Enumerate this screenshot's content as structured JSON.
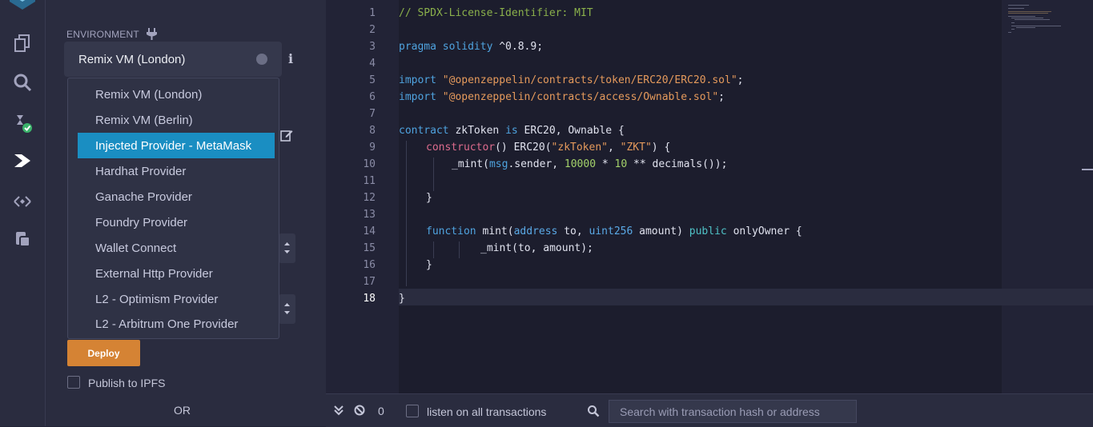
{
  "icons": {
    "logo": "remix-logo-icon",
    "file_explorer": "files-icon",
    "search": "search-icon",
    "compiler": "solidity-compiler-icon",
    "deploy_run": "deploy-run-icon",
    "plugin_manager": "plugin-manager-icon",
    "settings_docs": "docs-icon"
  },
  "panel": {
    "environment_label": "ENVIRONMENT",
    "environment_selected": "Remix VM (London)",
    "info_glyph": "i",
    "dropdown_options": [
      "Remix VM (London)",
      "Remix VM (Berlin)",
      "Injected Provider - MetaMask",
      "Hardhat Provider",
      "Ganache Provider",
      "Foundry Provider",
      "Wallet Connect",
      "External Http Provider",
      "L2 - Optimism Provider",
      "L2 - Arbitrum One Provider"
    ],
    "highlighted_option": "Injected Provider - MetaMask",
    "deploy_label": "Deploy",
    "publish_label": "Publish to IPFS",
    "or_label": "OR"
  },
  "editor": {
    "current_line": 18,
    "line_numbers": [
      "1",
      "2",
      "3",
      "4",
      "5",
      "6",
      "7",
      "8",
      "9",
      "10",
      "11",
      "12",
      "13",
      "14",
      "15",
      "16",
      "17",
      "18"
    ],
    "code": {
      "l1": "// SPDX-License-Identifier: MIT",
      "l3_kw": "pragma solidity",
      "l3_rest": " ^0.8.9;",
      "l5_kw": "import",
      "l5_str": "\"@openzeppelin/contracts/token/ERC20/ERC20.sol\"",
      "l5_end": ";",
      "l6_kw": "import",
      "l6_str": "\"@openzeppelin/contracts/access/Ownable.sol\"",
      "l6_end": ";",
      "l8_kw": "contract",
      "l8_name": " zkToken ",
      "l8_is": "is",
      "l8_rest": " ERC20, Ownable {",
      "l9_fn": "constructor",
      "l9_a": "() ERC20(",
      "l9_s1": "\"zkToken\"",
      "l9_b": ", ",
      "l9_s2": "\"ZKT\"",
      "l9_c": ") {",
      "l10_a": "_mint(",
      "l10_msg": "msg",
      "l10_b": ".sender, ",
      "l10_n1": "10000",
      "l10_c": " * ",
      "l10_n2": "10",
      "l10_d": " ** decimals());",
      "l12": "}",
      "l14_kw": "function",
      "l14_a": " mint(",
      "l14_t1": "address",
      "l14_b": " to, ",
      "l14_t2": "uint256",
      "l14_c": " amount) ",
      "l14_pub": "public",
      "l14_d": " onlyOwner {",
      "l15": "_mint(to, amount);",
      "l16": "}",
      "l18": "}"
    }
  },
  "terminal": {
    "count": "0",
    "listen_label": "listen on all transactions",
    "search_placeholder": "Search with transaction hash or address"
  }
}
